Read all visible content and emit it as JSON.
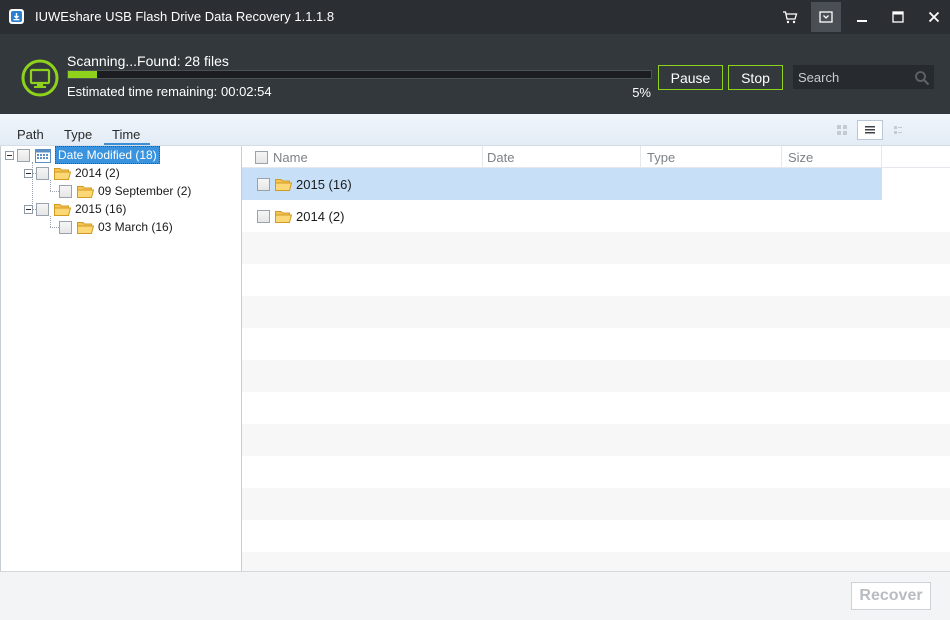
{
  "window": {
    "title": "IUWEshare USB Flash Drive Data Recovery 1.1.1.8",
    "icons": [
      "app-icon",
      "cart-icon",
      "dropdown-icon",
      "minimize-icon",
      "maximize-icon",
      "close-icon"
    ]
  },
  "scan": {
    "status": "Scanning...Found: 28 files",
    "time_label": "Estimated time remaining:",
    "time_value": "00:02:54",
    "progress_percent": 5,
    "progress_text": "5%",
    "pause_label": "Pause",
    "stop_label": "Stop",
    "search_placeholder": "Search"
  },
  "tabs": [
    {
      "label": "Path"
    },
    {
      "label": "Type"
    },
    {
      "label": "Time",
      "active": true
    }
  ],
  "tree": {
    "root": "Date Modified (18)",
    "items": [
      {
        "label": "2014 (2)",
        "children": [
          {
            "label": "09 September (2)"
          }
        ]
      },
      {
        "label": "2015 (16)",
        "children": [
          {
            "label": "03 March (16)"
          }
        ]
      }
    ]
  },
  "list": {
    "columns": [
      "Name",
      "Date",
      "Type",
      "Size"
    ],
    "rows": [
      {
        "name": "2015 (16)",
        "selected": true
      },
      {
        "name": "2014 (2)",
        "selected": false
      }
    ]
  },
  "footer": {
    "recover_label": "Recover"
  },
  "colors": {
    "accent_green": "#8ed21b",
    "titlebar": "#2b2f33",
    "scanbar": "#33383d",
    "selection": "#3a93de",
    "row_selected": "#c7e0f7"
  }
}
